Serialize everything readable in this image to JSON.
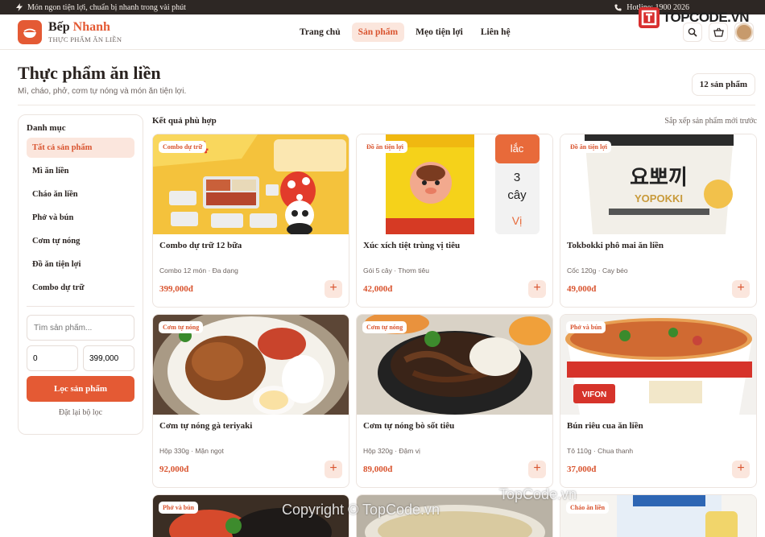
{
  "topbar": {
    "promo": "Món ngon tiện lợi, chuẩn bị nhanh trong vài phút",
    "hotline": "Hotline: 1900 2026"
  },
  "watermark_logo": "TOPCODE.VN",
  "brand": {
    "name_part1": "Bếp",
    "name_part2": "Nhanh",
    "subtitle": "THỰC PHẨM ĂN LIỀN"
  },
  "nav": {
    "items": [
      {
        "label": "Trang chủ",
        "active": false
      },
      {
        "label": "Sản phẩm",
        "active": true
      },
      {
        "label": "Mẹo tiện lợi",
        "active": false
      },
      {
        "label": "Liên hệ",
        "active": false
      }
    ]
  },
  "page": {
    "title": "Thực phẩm ăn liền",
    "description": "Mì, cháo, phở, cơm tự nóng và món ăn tiện lợi.",
    "count": "12 sản phẩm"
  },
  "sidebar": {
    "heading": "Danh mục",
    "categories": [
      {
        "label": "Tất cả sản phẩm",
        "active": true
      },
      {
        "label": "Mì ăn liền",
        "active": false
      },
      {
        "label": "Cháo ăn liền",
        "active": false
      },
      {
        "label": "Phở và bún",
        "active": false
      },
      {
        "label": "Cơm tự nóng",
        "active": false
      },
      {
        "label": "Đồ ăn tiện lợi",
        "active": false
      },
      {
        "label": "Combo dự trữ",
        "active": false
      }
    ],
    "search_placeholder": "Tìm sản phẩm...",
    "price_min": "0",
    "price_max": "399,000",
    "filter_button": "Lọc sản phẩm",
    "reset_link": "Đặt lại bộ lọc"
  },
  "results": {
    "heading": "Kết quả phù hợp",
    "sort_label": "Sắp xếp sản phẩm mới trước",
    "products": [
      {
        "tag": "Combo dự trữ",
        "name": "Combo dự trữ 12 bữa",
        "meta": "Combo 12 món · Đa dạng",
        "price": "399,000đ"
      },
      {
        "tag": "Đồ ăn tiện lợi",
        "name": "Xúc xích tiệt trùng vị tiêu",
        "meta": "Gói 5 cây · Thơm tiêu",
        "price": "42,000đ"
      },
      {
        "tag": "Đồ ăn tiện lợi",
        "name": "Tokbokki phô mai ăn liền",
        "meta": "Cốc 120g · Cay béo",
        "price": "49,000đ"
      },
      {
        "tag": "Cơm tự nóng",
        "name": "Cơm tự nóng gà teriyaki",
        "meta": "Hộp 330g · Mặn ngọt",
        "price": "92,000đ"
      },
      {
        "tag": "Cơm tự nóng",
        "name": "Cơm tự nóng bò sốt tiêu",
        "meta": "Hộp 320g · Đậm vị",
        "price": "89,000đ"
      },
      {
        "tag": "Phở và bún",
        "name": "Bún riêu cua ăn liền",
        "meta": "Tô 110g · Chua thanh",
        "price": "37,000đ"
      }
    ],
    "partial_tags": [
      "Phở và bún",
      "",
      "Cháo ăn liền"
    ],
    "add_symbol": "+"
  },
  "watermarks": {
    "center": "TopCode.vn",
    "copyright": "Copyright © TopCode.vn"
  },
  "colors": {
    "accent": "#e45a34",
    "accent_soft": "#fbe6dd",
    "topbar_bg": "#2d2724"
  }
}
